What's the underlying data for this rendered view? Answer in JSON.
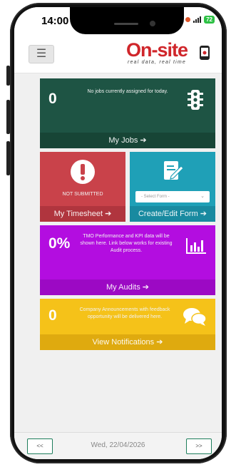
{
  "status_bar": {
    "time": "14:00",
    "battery": "72"
  },
  "header": {
    "menu_icon": "hamburger-icon",
    "logo_text": "On-site",
    "logo_tagline": "real data, real time"
  },
  "tiles": {
    "jobs": {
      "count": "0",
      "message": "No jobs currently assigned for today.",
      "footer": "My Jobs ➔",
      "icon": "traffic-light-icon",
      "color": "#1e5444"
    },
    "timesheet": {
      "status": "NOT SUBMITTED",
      "footer": "My Timesheet ➔",
      "icon": "exclamation-icon",
      "color": "#c9424a"
    },
    "form": {
      "select_placeholder": "- Select Form -",
      "footer": "Create/Edit Form ➔",
      "icon": "edit-document-icon",
      "color": "#1fa0b7"
    },
    "audits": {
      "percent": "0%",
      "message": "TMO Performance and KPI data will be shown here. Link below works for existing Audit process.",
      "footer": "My Audits ➔",
      "icon": "bar-chart-icon",
      "color": "#b30de0"
    },
    "notifications": {
      "count": "0",
      "message": "Company Announcements with feedback opportunity will be delivered here.",
      "footer": "View Notifications ➔",
      "icon": "chat-bubbles-icon",
      "color": "#f5c219"
    }
  },
  "bottom_bar": {
    "prev_label": "<<",
    "next_label": ">>",
    "date": "Wed, 22/04/2026"
  }
}
